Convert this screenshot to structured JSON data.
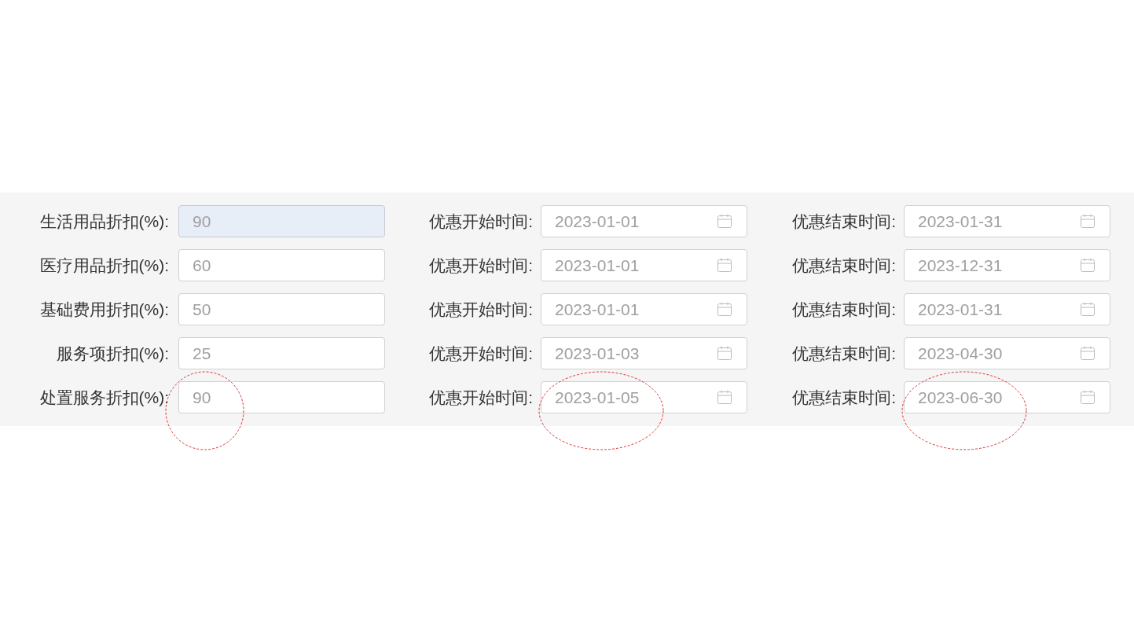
{
  "rows": [
    {
      "discount": {
        "label": "生活用品折扣(%):",
        "value": "90",
        "highlighted": true,
        "circled": false
      },
      "start": {
        "label": "优惠开始时间:",
        "value": "2023-01-01",
        "circled": false
      },
      "end": {
        "label": "优惠结束时间:",
        "value": "2023-01-31",
        "circled": false
      }
    },
    {
      "discount": {
        "label": "医疗用品折扣(%):",
        "value": "60",
        "highlighted": false,
        "circled": false
      },
      "start": {
        "label": "优惠开始时间:",
        "value": "2023-01-01",
        "circled": false
      },
      "end": {
        "label": "优惠结束时间:",
        "value": "2023-12-31",
        "circled": false
      }
    },
    {
      "discount": {
        "label": "基础费用折扣(%):",
        "value": "50",
        "highlighted": false,
        "circled": false
      },
      "start": {
        "label": "优惠开始时间:",
        "value": "2023-01-01",
        "circled": false
      },
      "end": {
        "label": "优惠结束时间:",
        "value": "2023-01-31",
        "circled": false
      }
    },
    {
      "discount": {
        "label": "服务项折扣(%):",
        "value": "25",
        "highlighted": false,
        "circled": false
      },
      "start": {
        "label": "优惠开始时间:",
        "value": "2023-01-03",
        "circled": false
      },
      "end": {
        "label": "优惠结束时间:",
        "value": "2023-04-30",
        "circled": false
      }
    },
    {
      "discount": {
        "label": "处置服务折扣(%):",
        "value": "90",
        "highlighted": false,
        "circled": true
      },
      "start": {
        "label": "优惠开始时间:",
        "value": "2023-01-05",
        "circled": true
      },
      "end": {
        "label": "优惠结束时间:",
        "value": "2023-06-30",
        "circled": true
      }
    }
  ]
}
